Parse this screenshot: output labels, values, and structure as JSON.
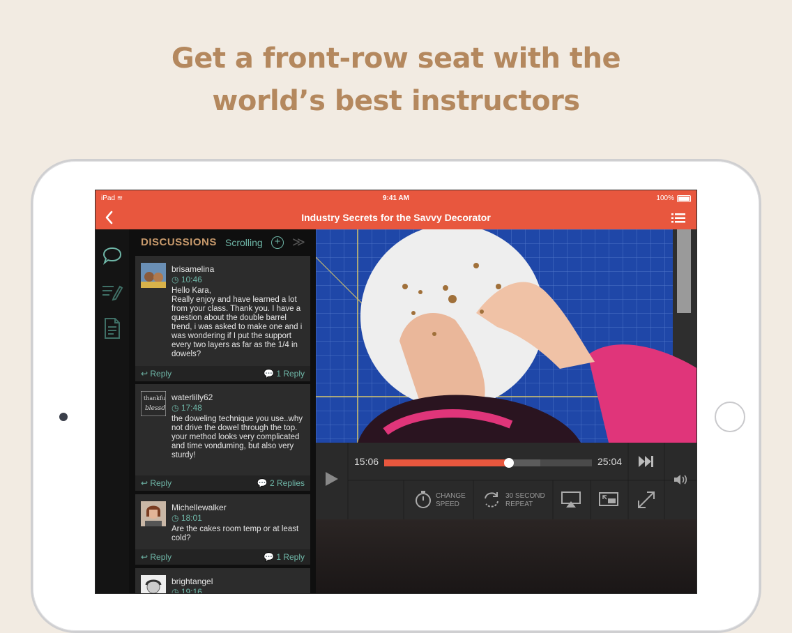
{
  "headline": {
    "line1": "Get a front-row seat with the",
    "line2": "world’s best instructors"
  },
  "status_bar": {
    "device": "iPad",
    "time": "9:41 AM",
    "battery": "100%"
  },
  "nav": {
    "title": "Industry Secrets for the Savvy Decorator",
    "back_icon": "chevron-left-icon",
    "menu_icon": "list-icon"
  },
  "sidebar_icons": [
    "chat-bubble-icon",
    "notes-pencil-icon",
    "document-icon"
  ],
  "discussions": {
    "heading": "DISCUSSIONS",
    "mode": "Scrolling",
    "posts": [
      {
        "user": "brisamelina",
        "time": "10:46",
        "message": "Hello Kara,\nReally enjoy and have learned a lot from your class. Thank you. I have a question about the double barrel trend, i was asked to make one and i was wondering if I put the support every two layers as far as the 1/4 in dowels?",
        "reply_label": "Reply",
        "replies": "1 Reply"
      },
      {
        "user": "waterlilly62",
        "time": "17:48",
        "message": "the doweling technique you use..why not drive the dowel through the top.\nyour method looks very complicated and time vonduming, but also very sturdy!",
        "reply_label": "Reply",
        "replies": "2 Replies"
      },
      {
        "user": "Michellewalker",
        "time": "18:01",
        "message": "Are the cakes room temp or at least cold?",
        "reply_label": "Reply",
        "replies": "1 Reply"
      },
      {
        "user": "brightangel",
        "time": "19:16",
        "message": "",
        "reply_label": "",
        "replies": ""
      }
    ]
  },
  "player": {
    "elapsed": "15:06",
    "duration": "25:04",
    "progress": 0.6,
    "buffered": 0.75,
    "change_speed_line1": "CHANGE",
    "change_speed_line2": "SPEED",
    "repeat_line1": "30 SECOND",
    "repeat_line2": "REPEAT"
  },
  "colors": {
    "accent": "#e8573e",
    "teal": "#6fb7a8",
    "gold": "#c89a6c",
    "headline": "#b4885e"
  }
}
